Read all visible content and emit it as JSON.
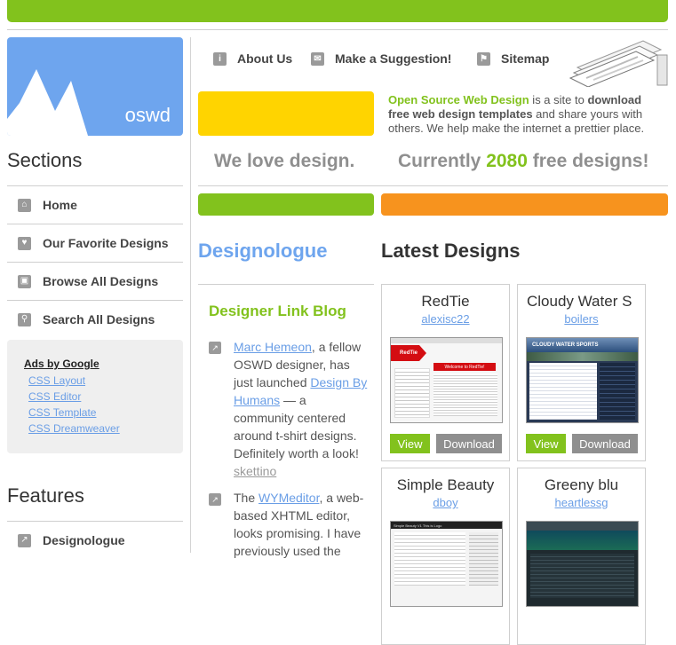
{
  "logo": {
    "text": "oswd"
  },
  "sidebar": {
    "sections_title": "Sections",
    "items": [
      {
        "label": "Home",
        "icon": "home-icon"
      },
      {
        "label": "Our Favorite Designs",
        "icon": "heart-icon"
      },
      {
        "label": "Browse All Designs",
        "icon": "browse-icon"
      },
      {
        "label": "Search All Designs",
        "icon": "search-icon"
      }
    ],
    "ads": {
      "title": "Ads by Google",
      "links": [
        "CSS Layout",
        "CSS Editor",
        "CSS Template",
        "CSS Dreamweaver"
      ]
    },
    "features_title": "Features",
    "features_items": [
      {
        "label": "Designologue",
        "icon": "arrow-icon"
      }
    ]
  },
  "topnav": {
    "about": "About Us",
    "suggest": "Make a Suggestion!",
    "sitemap": "Sitemap"
  },
  "intro": {
    "brand": "Open Source Web Design",
    "t1": " is a site to ",
    "bold": "download free web design templates",
    "t2": " and share yours with others. We help make the internet a prettier place."
  },
  "tagline": {
    "love": "We love design.",
    "count_pre": "Currently ",
    "count_num": "2080",
    "count_post": " free designs!"
  },
  "designologue": {
    "title": "Designologue",
    "blog_title": "Designer Link Blog",
    "post1": {
      "link1": "Marc Hemeon",
      "t1": ", a fellow OSWD designer, has just launched ",
      "link2": "Design By Humans",
      "t2": " — a community centered around t-shirt designs. Definitely worth a look! ",
      "author": "skettino"
    },
    "post2": {
      "t0": "The ",
      "link1": "WYMeditor",
      "t1": ", a web-based XHTML editor, looks promising. I have previously used the"
    }
  },
  "latest": {
    "title": "Latest Designs",
    "view_label": "View",
    "download_label": "Download",
    "designs": [
      {
        "name": "RedTie",
        "author": "alexisc22",
        "thumb_text": "Welcome to RedTie!",
        "badge": "RedTie"
      },
      {
        "name": "Cloudy Water S",
        "author": "boilers",
        "thumb_text": "CLOUDY WATER SPORTS"
      },
      {
        "name": "Simple Beauty",
        "author": "dboy",
        "thumb_text": "Simple Beauty V1 This is Logo"
      },
      {
        "name": "Greeny blu",
        "author": "heartlessg",
        "thumb_text": ""
      }
    ]
  },
  "colors": {
    "green": "#82c21d",
    "blue": "#6ea5ee",
    "yellow": "#ffd400",
    "orange": "#f7931e",
    "gray": "#8f8f8f",
    "link": "#6a9ee6"
  }
}
